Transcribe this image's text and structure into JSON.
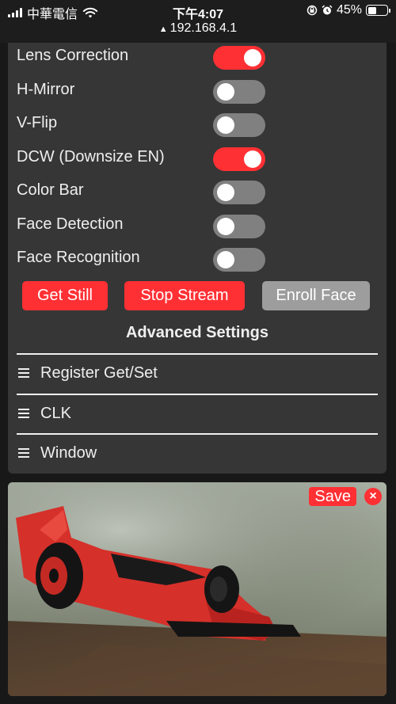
{
  "status_bar": {
    "carrier": "中華電信",
    "time": "下午4:07",
    "battery": "45%",
    "battery_level": 0.45,
    "url": "192.168.4.1"
  },
  "toggles": [
    {
      "label": "Lens Correction",
      "on": true
    },
    {
      "label": "H-Mirror",
      "on": false
    },
    {
      "label": "V-Flip",
      "on": false
    },
    {
      "label": "DCW (Downsize EN)",
      "on": true
    },
    {
      "label": "Color Bar",
      "on": false
    },
    {
      "label": "Face Detection",
      "on": false
    },
    {
      "label": "Face Recognition",
      "on": false
    }
  ],
  "buttons": {
    "get_still": "Get Still",
    "stop_stream": "Stop Stream",
    "enroll_face": "Enroll Face"
  },
  "advanced": {
    "title": "Advanced Settings",
    "sections": [
      "Register Get/Set",
      "CLK",
      "Window"
    ]
  },
  "preview": {
    "save_label": "Save",
    "close_label": "×"
  },
  "colors": {
    "accent": "#ff3034",
    "panel": "#363636",
    "background": "#181818",
    "toggle_off": "#808080",
    "disabled": "#9d9d9d"
  }
}
